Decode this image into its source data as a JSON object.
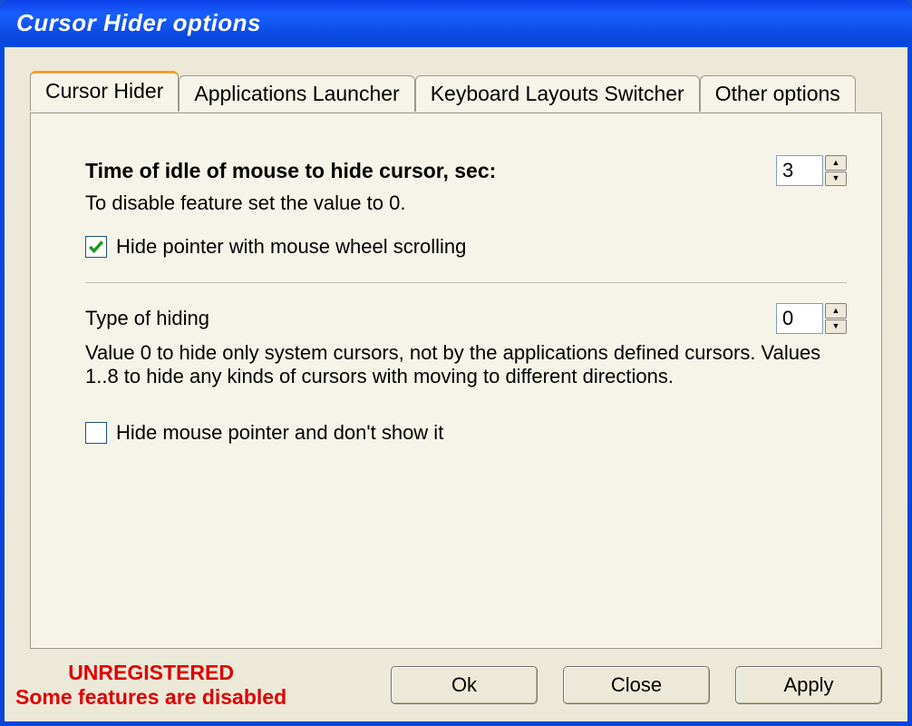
{
  "window": {
    "title": "Cursor Hider options"
  },
  "tabs": [
    {
      "label": "Cursor Hider",
      "active": true
    },
    {
      "label": "Applications Launcher",
      "active": false
    },
    {
      "label": "Keyboard Layouts Switcher",
      "active": false
    },
    {
      "label": "Other options",
      "active": false
    }
  ],
  "options": {
    "idle_label": "Time of idle of mouse to hide cursor, sec:",
    "idle_help": "To disable feature set the value to 0.",
    "idle_value": "3",
    "hide_wheel_label": "Hide pointer with mouse wheel scrolling",
    "hide_wheel_checked": true,
    "type_label": "Type of hiding",
    "type_value": "0",
    "type_help": "Value 0 to hide only system cursors, not by the applications defined cursors. Values 1..8 to hide any kinds of cursors with moving to different directions.",
    "hide_always_label": "Hide mouse pointer and don't show it",
    "hide_always_checked": false
  },
  "footer": {
    "unregistered_line1": "UNREGISTERED",
    "unregistered_line2": "Some features are disabled",
    "ok": "Ok",
    "close": "Close",
    "apply": "Apply"
  }
}
